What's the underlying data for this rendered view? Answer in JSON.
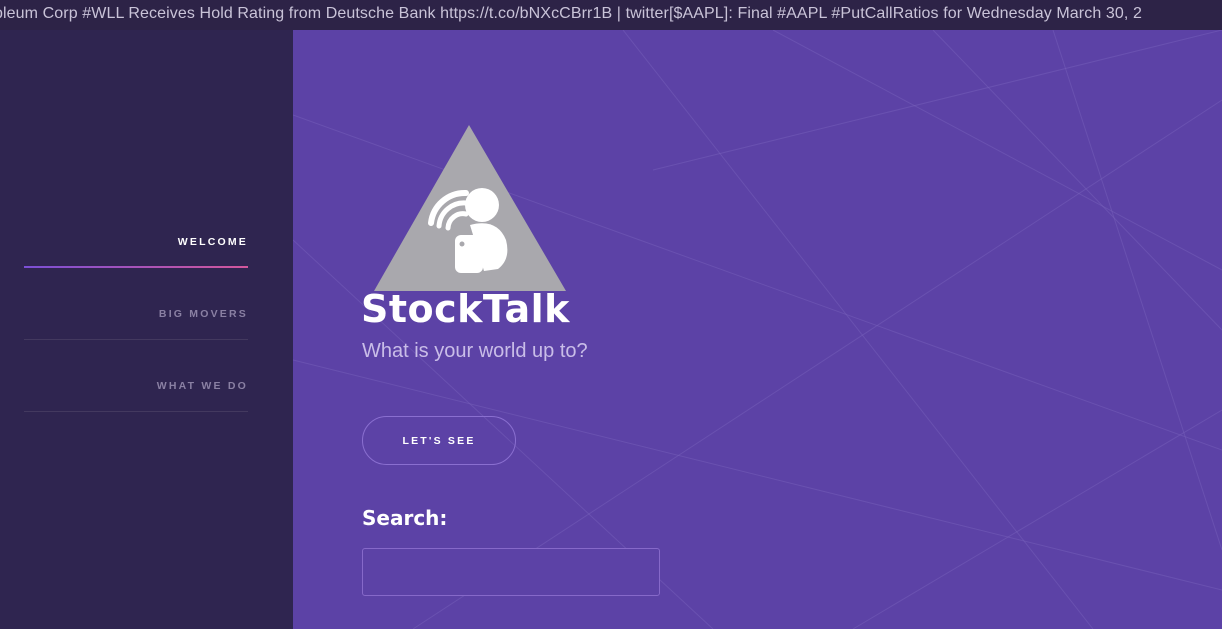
{
  "ticker": {
    "text": "pleum Corp #WLL Receives Hold Rating from Deutsche Bank https://t.co/bNXcCBrr1B | twitter[$AAPL]: Final #AAPL #PutCallRatios for Wednesday March 30, 2"
  },
  "sidebar": {
    "items": [
      {
        "label": "WELCOME",
        "active": true
      },
      {
        "label": "BIG MOVERS",
        "active": false
      },
      {
        "label": "WHAT WE DO",
        "active": false
      }
    ]
  },
  "hero": {
    "brand": "StockTalk",
    "tagline": "What is your world up to?",
    "cta_label": "LET'S SEE",
    "logo_icon": "person-wifi-triangle-icon"
  },
  "search": {
    "label": "Search:",
    "value": "",
    "placeholder": ""
  },
  "colors": {
    "sidebar_bg": "#2f2550",
    "main_bg": "#5c42a6",
    "accent_gradient_start": "#7b4fd6",
    "accent_gradient_end": "#d3579c",
    "logo_gray": "#a9a8ad"
  }
}
